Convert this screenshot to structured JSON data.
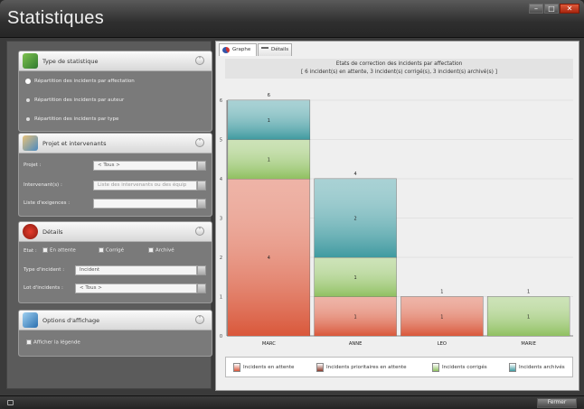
{
  "window": {
    "title": "Statistiques"
  },
  "panels": {
    "type": {
      "title": "Type de statistique",
      "options": [
        "Répartition des incidents par affectation",
        "Répartition des incidents par auteur",
        "Répartition des incidents par type"
      ],
      "selected": 0
    },
    "projet": {
      "title": "Projet et intervenants",
      "projet_label": "Projet :",
      "projet_value": "< Tous >",
      "intervenants_label": "Intervenant(s) :",
      "intervenants_placeholder": "Liste des intervenants ou des équip",
      "exigences_label": "Liste d'exigences :"
    },
    "details": {
      "title": "Détails",
      "etat_label": "Etat :",
      "etat_attente": "En attente",
      "etat_corrige": "Corrigé",
      "etat_archive": "Archivé",
      "type_label": "Type d'incident :",
      "type_value": "Incident",
      "lot_label": "Lot d'incidents :",
      "lot_value": "< Tous >"
    },
    "affichage": {
      "title": "Options d'affichage",
      "legend_label": "Afficher la légende"
    }
  },
  "tabs": [
    "Graphe",
    "Détails"
  ],
  "chart_title": {
    "line1": "Etats de correction des incidents par affectation",
    "line2": "[ 6 incident(s) en attente, 3 incident(s) corrigé(s), 3 incident(s) archivé(s) ]"
  },
  "chart_data": {
    "type": "bar",
    "stacked": true,
    "categories": [
      "MARC",
      "ANNE",
      "LEO",
      "MARIE"
    ],
    "ylim": [
      0,
      6
    ],
    "yticks": [
      0,
      1,
      2,
      3,
      4,
      5,
      6
    ],
    "series": [
      {
        "name": "Incidents en attente",
        "color": "#d9573a",
        "values": [
          4,
          1,
          1,
          0
        ]
      },
      {
        "name": "Incidents prioritaires en attente",
        "color": "#8a3a2a",
        "values": [
          0,
          0,
          0,
          0
        ]
      },
      {
        "name": "Incidents corrigés",
        "color": "#8fc060",
        "values": [
          1,
          1,
          0,
          1
        ]
      },
      {
        "name": "Incidents archivés",
        "color": "#3f9aa0",
        "values": [
          1,
          2,
          0,
          0
        ]
      }
    ],
    "totals": [
      6,
      4,
      1,
      1
    ]
  },
  "statusbar": {
    "close_label": "Fermer"
  }
}
